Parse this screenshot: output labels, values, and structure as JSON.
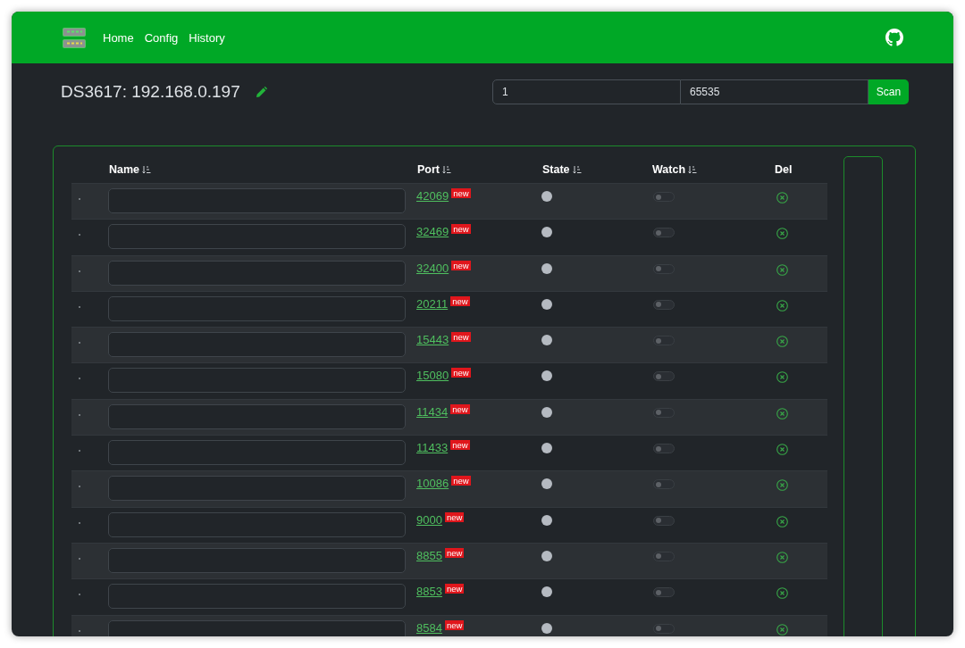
{
  "navbar": {
    "links": [
      {
        "label": "Home"
      },
      {
        "label": "Config"
      },
      {
        "label": "History"
      }
    ]
  },
  "header": {
    "title": "DS3617: 192.168.0.197"
  },
  "scan": {
    "start": "1",
    "end": "65535",
    "button": "Scan"
  },
  "table": {
    "columns": [
      {
        "label": "Name",
        "sortable": true
      },
      {
        "label": "Port",
        "sortable": true
      },
      {
        "label": "State",
        "sortable": true
      },
      {
        "label": "Watch",
        "sortable": true
      },
      {
        "label": "Del",
        "sortable": false
      }
    ],
    "rows": [
      {
        "port": "42069",
        "badge": "new",
        "color": "#b5bac1",
        "watch": false
      },
      {
        "port": "32469",
        "badge": "new",
        "color": "#b5bac1",
        "watch": false
      },
      {
        "port": "32400",
        "badge": "new",
        "color": "#b5bac1",
        "watch": false
      },
      {
        "port": "20211",
        "badge": "new",
        "color": "#b5bac1",
        "watch": false
      },
      {
        "port": "15443",
        "badge": "new",
        "color": "#b5bac1",
        "watch": false
      },
      {
        "port": "15080",
        "badge": "new",
        "color": "#b5bac1",
        "watch": false
      },
      {
        "port": "11434",
        "badge": "new",
        "color": "#b5bac1",
        "watch": false
      },
      {
        "port": "11433",
        "badge": "new",
        "color": "#b5bac1",
        "watch": false
      },
      {
        "port": "10086",
        "badge": "new",
        "color": "#b5bac1",
        "watch": false
      },
      {
        "port": "9000",
        "badge": "new",
        "color": "#b5bac1",
        "watch": false
      },
      {
        "port": "8855",
        "badge": "new",
        "color": "#b5bac1",
        "watch": false
      },
      {
        "port": "8853",
        "badge": "new",
        "color": "#b5bac1",
        "watch": false
      },
      {
        "port": "8584",
        "badge": "new",
        "color": "#b5bac1",
        "watch": false
      }
    ]
  }
}
